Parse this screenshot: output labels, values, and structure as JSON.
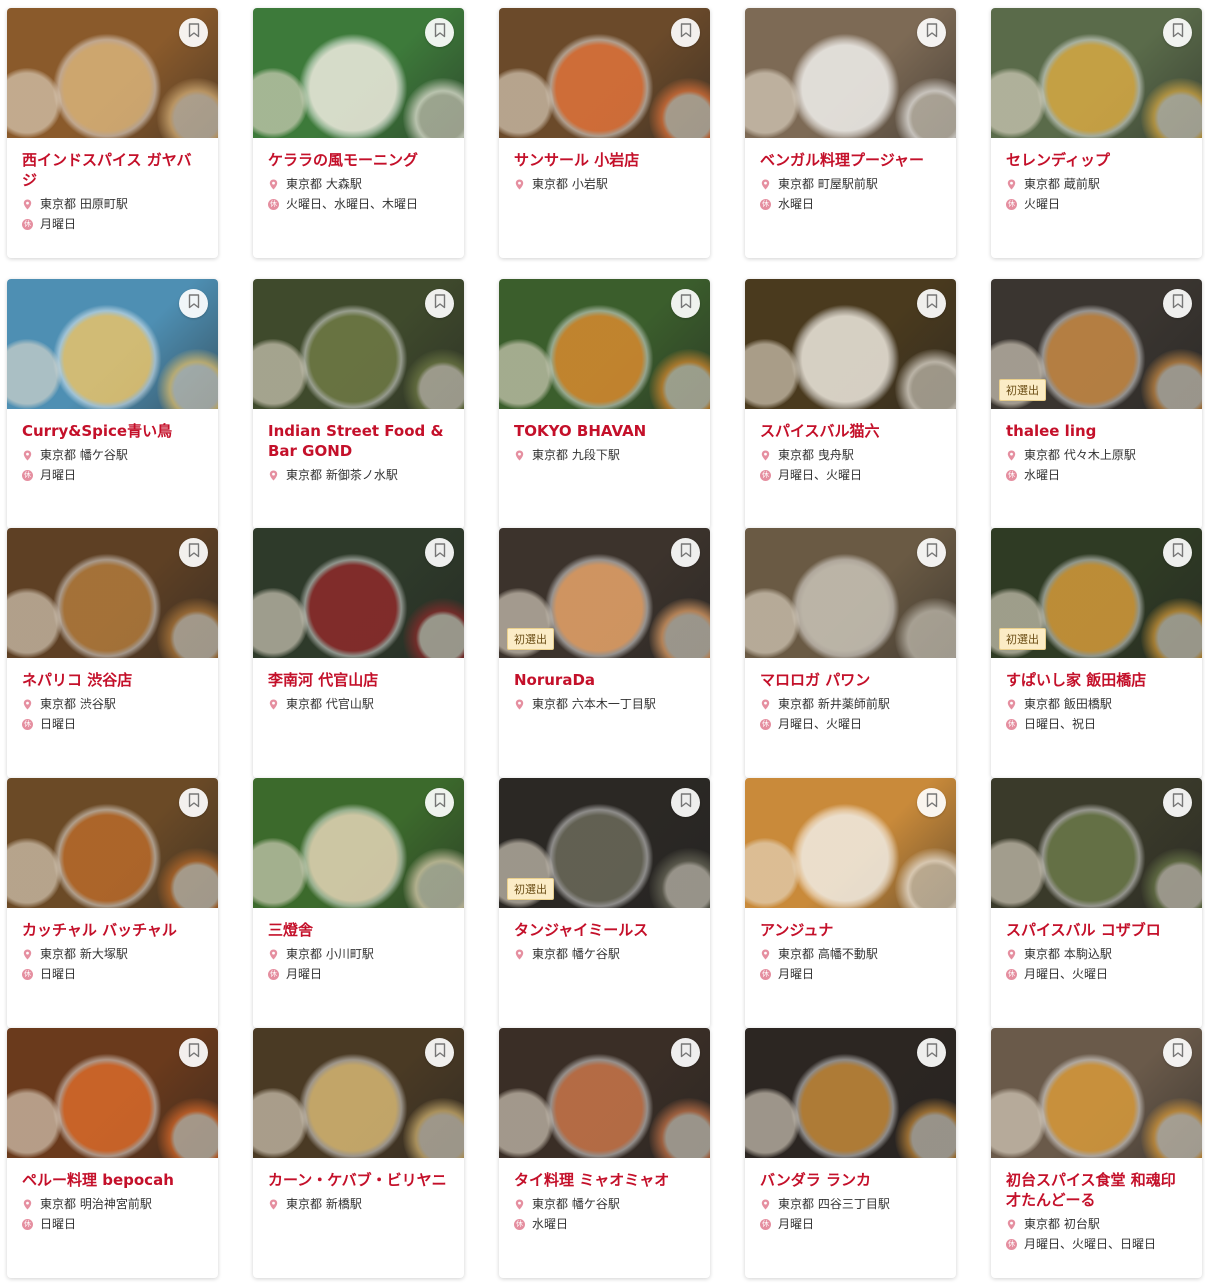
{
  "colors": {
    "accent": "#c4102a",
    "badge_bg": "#fbecc6",
    "pin": "#e58fa0"
  },
  "icons": {
    "bookmark": "bookmark-icon",
    "location": "location-pin-icon",
    "closed": "closed-day-icon"
  },
  "closed_icon_glyph": "休",
  "cards": [
    {
      "name": "西インドスパイス ガヤバジ",
      "location": "東京都 田原町駅",
      "closed": "月曜日",
      "badge": "",
      "bg": "#8a5a2b",
      "plate": "#d9b37a"
    },
    {
      "name": "ケララの風モーニング",
      "location": "東京都 大森駅",
      "closed": "火曜日、水曜日、木曜日",
      "badge": "",
      "bg": "#3d7a3a",
      "plate": "#f1ede2"
    },
    {
      "name": "サンサール 小岩店",
      "location": "東京都 小岩駅",
      "closed": "",
      "badge": "",
      "bg": "#6b4a2a",
      "plate": "#e0733a"
    },
    {
      "name": "ベンガル料理プージャー",
      "location": "東京都 町屋駅前駅",
      "closed": "水曜日",
      "badge": "",
      "bg": "#7d6a55",
      "plate": "#f2f1ee"
    },
    {
      "name": "セレンディップ",
      "location": "東京都 蔵前駅",
      "closed": "火曜日",
      "badge": "",
      "bg": "#5a6b4a",
      "plate": "#d7a943"
    },
    {
      "name": "Curry&Spice青い鳥",
      "location": "東京都 幡ケ谷駅",
      "closed": "月曜日",
      "badge": "",
      "bg": "#4e8fb3",
      "plate": "#e8c36a"
    },
    {
      "name": "Indian Street Food & Bar GOND",
      "location": "東京都 新御茶ノ水駅",
      "closed": "",
      "badge": "",
      "bg": "#3f4a2c",
      "plate": "#6f7a45"
    },
    {
      "name": "TOKYO BHAVAN",
      "location": "東京都 九段下駅",
      "closed": "",
      "badge": "",
      "bg": "#3b5e2c",
      "plate": "#d88a2f"
    },
    {
      "name": "スパイスバル猫六",
      "location": "東京都 曳舟駅",
      "closed": "月曜日、火曜日",
      "badge": "",
      "bg": "#4a3a1e",
      "plate": "#efeae0"
    },
    {
      "name": "thalee ling",
      "location": "東京都 代々木上原駅",
      "closed": "水曜日",
      "badge": "初選出",
      "bg": "#3a3530",
      "plate": "#c98b45"
    },
    {
      "name": "ネパリコ 渋谷店",
      "location": "東京都 渋谷駅",
      "closed": "日曜日",
      "badge": "",
      "bg": "#5e4024",
      "plate": "#b07a3c"
    },
    {
      "name": "李南河 代官山店",
      "location": "東京都 代官山駅",
      "closed": "",
      "badge": "",
      "bg": "#2e3a2a",
      "plate": "#8e2a2a"
    },
    {
      "name": "NoruraDa",
      "location": "東京都 六本木一丁目駅",
      "closed": "",
      "badge": "初選出",
      "bg": "#3c332c",
      "plate": "#e9a56a"
    },
    {
      "name": "マロロガ パワン",
      "location": "東京都 新井薬師前駅",
      "closed": "月曜日、火曜日",
      "badge": "",
      "bg": "#6a5a44",
      "plate": "#c9c4b8"
    },
    {
      "name": "すぱいし家 飯田橋店",
      "location": "東京都 飯田橋駅",
      "closed": "日曜日、祝日",
      "badge": "初選出",
      "bg": "#2f3b24",
      "plate": "#d59b3a"
    },
    {
      "name": "カッチャル バッチャル",
      "location": "東京都 新大塚駅",
      "closed": "日曜日",
      "badge": "",
      "bg": "#6b4a26",
      "plate": "#b86a2a"
    },
    {
      "name": "三燈舎",
      "location": "東京都 小川町駅",
      "closed": "月曜日",
      "badge": "",
      "bg": "#3c6a2c",
      "plate": "#e6d6b8"
    },
    {
      "name": "タンジャイミールス",
      "location": "東京都 幡ケ谷駅",
      "closed": "",
      "badge": "初選出",
      "bg": "#2b2824",
      "plate": "#6b6a5a"
    },
    {
      "name": "アンジュナ",
      "location": "東京都 高幡不動駅",
      "closed": "月曜日",
      "badge": "",
      "bg": "#c98a3a",
      "plate": "#f1ede5"
    },
    {
      "name": "スパイスバル コザブロ",
      "location": "東京都 本駒込駅",
      "closed": "月曜日、火曜日",
      "badge": "",
      "bg": "#3a3a2a",
      "plate": "#6c7a4a"
    },
    {
      "name": "ペルー料理 bepocah",
      "location": "東京都 明治神宮前駅",
      "closed": "日曜日",
      "badge": "",
      "bg": "#6a3a1c",
      "plate": "#d86a2a"
    },
    {
      "name": "カーン・ケバブ・ビリヤニ",
      "location": "東京都 新橋駅",
      "closed": "",
      "badge": "",
      "bg": "#4a3a24",
      "plate": "#d7b874"
    },
    {
      "name": "タイ料理 ミャオミャオ",
      "location": "東京都 幡ケ谷駅",
      "closed": "水曜日",
      "badge": "",
      "bg": "#3a2e26",
      "plate": "#c9764a"
    },
    {
      "name": "バンダラ ランカ",
      "location": "東京都 四谷三丁目駅",
      "closed": "月曜日",
      "badge": "",
      "bg": "#2c2622",
      "plate": "#c58a3a"
    },
    {
      "name": "初台スパイス食堂 和魂印才たんどーる",
      "location": "東京都 初台駅",
      "closed": "月曜日、火曜日、日曜日",
      "badge": "",
      "bg": "#6a5a4a",
      "plate": "#d89a3a"
    }
  ]
}
